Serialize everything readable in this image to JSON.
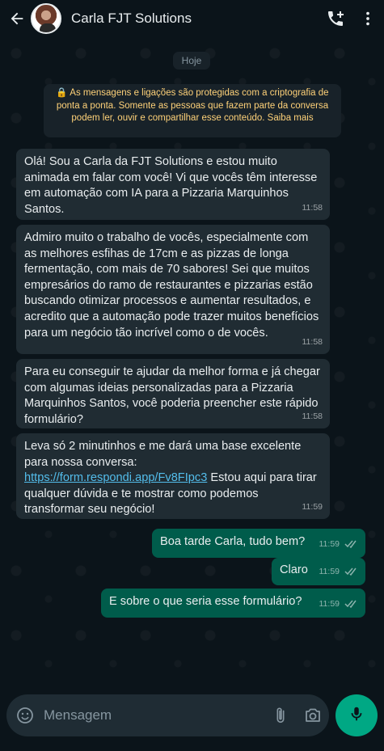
{
  "header": {
    "contact_name": "Carla FJT Solutions"
  },
  "chat": {
    "date_label": "Hoje",
    "encryption_notice": "🔒 As mensagens e ligações são protegidas com a criptografia de ponta a ponta. Somente as pessoas que fazem parte da conversa podem ler, ouvir e compartilhar esse conteúdo. Saiba mais",
    "messages": [
      {
        "direction": "in",
        "text": "Olá! Sou a Carla da FJT Solutions e estou muito animada em falar com você! Vi que vocês têm interesse em automação com IA para a Pizzaria Marquinhos Santos.",
        "time": "11:58"
      },
      {
        "direction": "in",
        "text": "Admiro muito o trabalho de vocês, especialmente com as melhores esfihas de 17cm e as pizzas de longa fermentação, com mais de 70 sabores! Sei que muitos empresários do ramo de restaurantes e pizzarias estão buscando otimizar processos e aumentar resultados, e acredito que a automação pode trazer muitos benefícios para um negócio tão incrível como o de vocês.",
        "time": "11:58"
      },
      {
        "direction": "in",
        "text": "Para eu conseguir te ajudar da melhor forma e já chegar com algumas ideias personalizadas para a Pizzaria Marquinhos Santos, você poderia preencher este rápido formulário?",
        "time": "11:58"
      },
      {
        "direction": "in",
        "text_before": "Leva só 2 minutinhos e me dará uma base excelente para nossa conversa: ",
        "link": "https://form.respondi.app/Fv8FIpc3",
        "text_after": " Estou aqui para tirar qualquer dúvida e te mostrar como podemos transformar seu negócio!",
        "time": "11:59"
      },
      {
        "direction": "out",
        "text": "Boa tarde Carla, tudo bem?",
        "time": "11:59"
      },
      {
        "direction": "out",
        "text": "Claro",
        "time": "11:59"
      },
      {
        "direction": "out",
        "text": "E sobre o que seria esse formulário?",
        "time": "11:59"
      }
    ]
  },
  "composer": {
    "placeholder": "Mensagem"
  },
  "colors": {
    "background": "#0b141a",
    "incoming_bubble": "#202c33",
    "outgoing_bubble": "#005c4b",
    "link": "#53bdeb",
    "accent": "#00a884",
    "encryption_text": "#ffd279"
  },
  "icons": [
    "back-arrow-icon",
    "add-call-icon",
    "more-vert-icon",
    "lock-icon",
    "read-ticks-icon",
    "sticker-icon",
    "attach-icon",
    "camera-icon",
    "mic-icon"
  ]
}
